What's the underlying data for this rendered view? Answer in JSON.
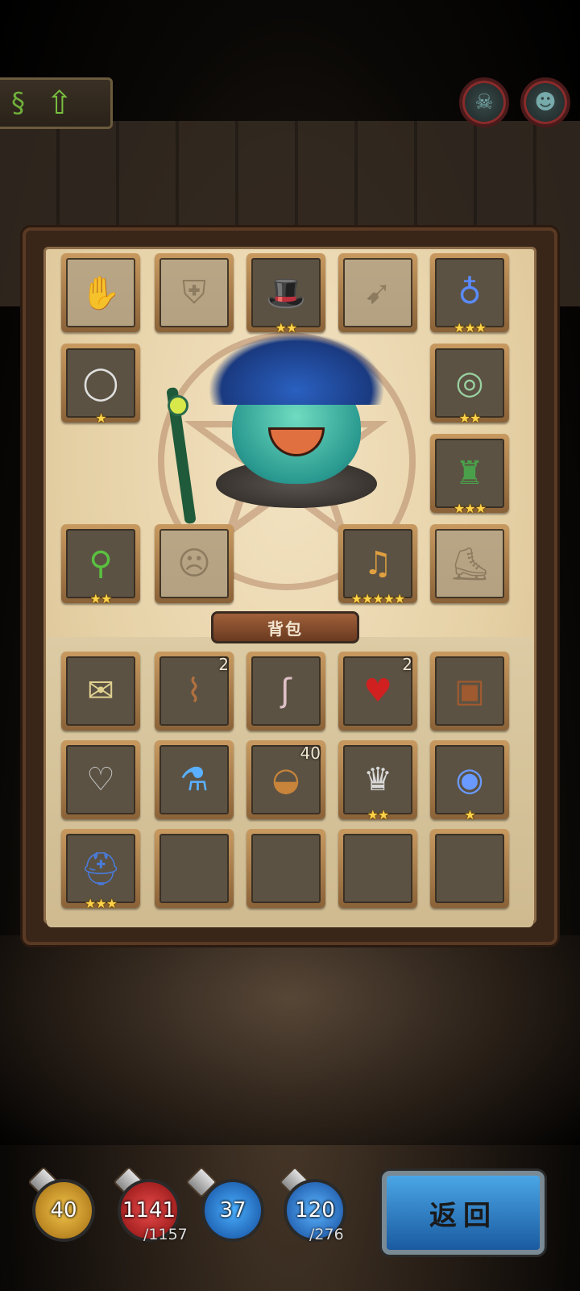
{
  "topbar": {
    "skill_icon": "dragon-rune-icon",
    "upgrade_icon": "green-up-arrow-icon",
    "portraits": [
      "red-demon-portrait",
      "ghost-portrait"
    ]
  },
  "equipment": {
    "slots": [
      {
        "name": "equip-slot-gloves",
        "icon": "gloves-icon",
        "ghost": true,
        "stars": ""
      },
      {
        "name": "equip-slot-armor",
        "icon": "armor-icon",
        "ghost": true,
        "stars": ""
      },
      {
        "name": "equip-slot-hat",
        "icon": "black-hat-icon",
        "ghost": false,
        "stars": "★★"
      },
      {
        "name": "equip-slot-crossbow",
        "icon": "crossbow-icon",
        "ghost": true,
        "stars": ""
      },
      {
        "name": "equip-slot-amulet",
        "icon": "blue-amulet-icon",
        "ghost": false,
        "stars": "★★★"
      },
      {
        "name": "equip-slot-ring-left",
        "icon": "silver-ring-icon",
        "ghost": false,
        "stars": "★"
      },
      {
        "name": "equip-slot-ring-right",
        "icon": "green-ring-icon",
        "ghost": false,
        "stars": "★★"
      },
      {
        "name": "equip-slot-cloak",
        "icon": "green-cloak-icon",
        "ghost": false,
        "stars": "★★★"
      },
      {
        "name": "equip-slot-staff",
        "icon": "vine-staff-icon",
        "ghost": false,
        "stars": "★★"
      },
      {
        "name": "equip-slot-mask",
        "icon": "mask-icon",
        "ghost": true,
        "stars": ""
      },
      {
        "name": "equip-slot-lyre",
        "icon": "lyre-icon",
        "ghost": false,
        "stars": "★★★★★"
      },
      {
        "name": "equip-slot-boots",
        "icon": "boots-icon",
        "ghost": true,
        "stars": ""
      }
    ]
  },
  "hero": {
    "name_icon": "slime-hero"
  },
  "bag": {
    "title": "背包",
    "items": [
      {
        "icon": "map-scroll-icon",
        "count": "",
        "stars": ""
      },
      {
        "icon": "rolled-scroll-icon",
        "count": "2",
        "stars": ""
      },
      {
        "icon": "ear-icon",
        "count": "",
        "stars": ""
      },
      {
        "icon": "red-heart-icon",
        "count": "2",
        "stars": ""
      },
      {
        "icon": "leather-book-icon",
        "count": "",
        "stars": ""
      },
      {
        "icon": "mech-heart-icon",
        "count": "",
        "stars": ""
      },
      {
        "icon": "blue-potion-icon",
        "count": "",
        "stars": ""
      },
      {
        "icon": "bread-icon",
        "count": "40",
        "stars": ""
      },
      {
        "icon": "trophy-shield-icon",
        "count": "",
        "stars": "★★"
      },
      {
        "icon": "sapphire-ring-icon",
        "count": "",
        "stars": "★"
      },
      {
        "icon": "blue-helmet-icon",
        "count": "",
        "stars": "★★★"
      },
      {
        "icon": "",
        "count": "",
        "stars": ""
      },
      {
        "icon": "",
        "count": "",
        "stars": ""
      },
      {
        "icon": "",
        "count": "",
        "stars": ""
      },
      {
        "icon": "",
        "count": "",
        "stars": ""
      }
    ]
  },
  "stats": {
    "attack": "40",
    "hp": "1141",
    "hp_max": "/1157",
    "mana": "37",
    "exp": "120",
    "exp_max": "/276"
  },
  "back_button": "返回"
}
